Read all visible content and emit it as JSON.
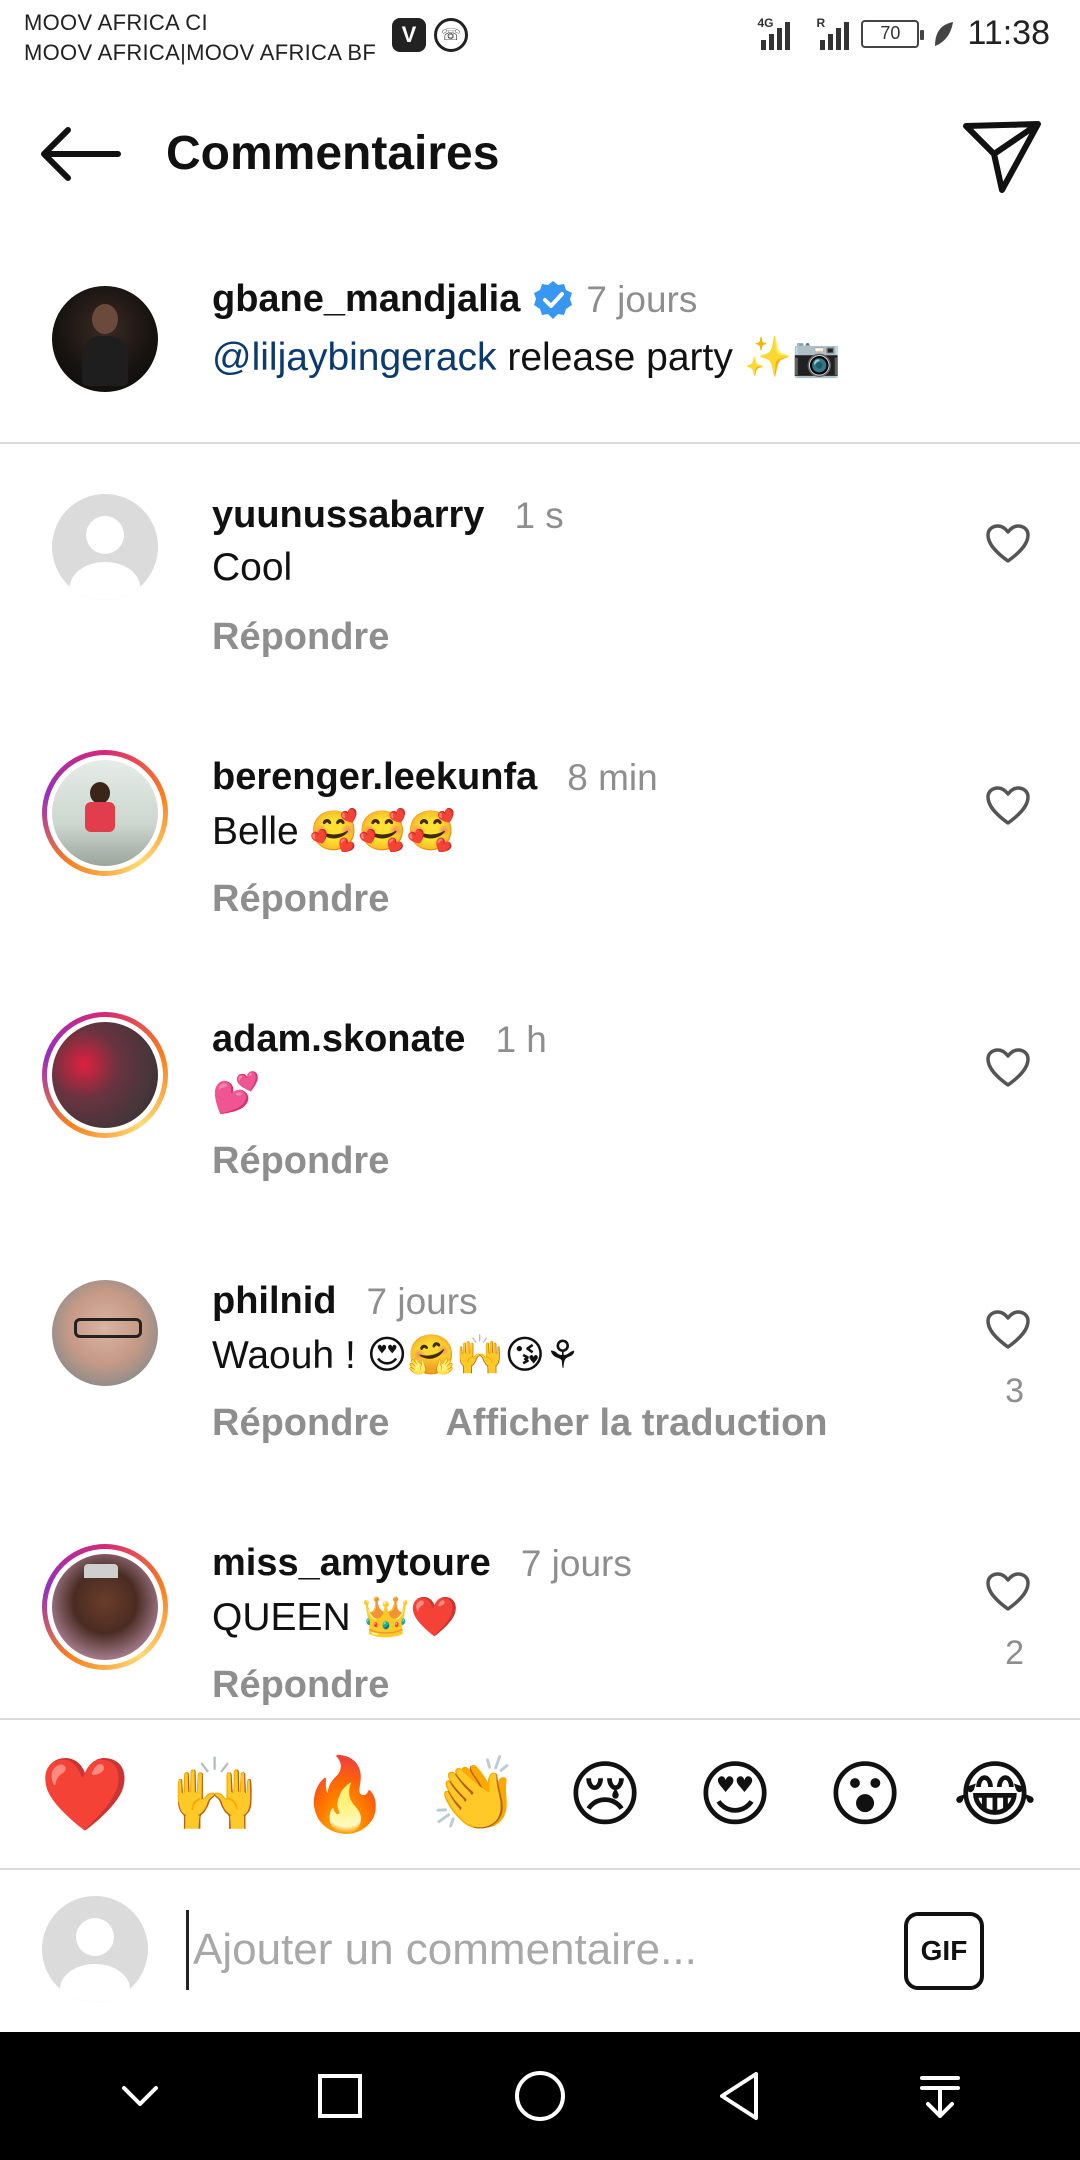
{
  "status_bar": {
    "carrier_line1": "MOOV AFRICA CI",
    "carrier_line2": "MOOV AFRICA|MOOV AFRICA BF",
    "app_icon_v": "V",
    "network_tag_1": "4G",
    "network_tag_2": "R",
    "battery": "70",
    "time": "11:38"
  },
  "header": {
    "title": "Commentaires"
  },
  "caption": {
    "username": "gbane_mandjalia",
    "verified": true,
    "time": "7 jours",
    "mention": "@liljaybingerack",
    "text": " release party ",
    "emojis": "✨📷"
  },
  "comments": [
    {
      "username": "yuunussabarry",
      "time": "1 s",
      "text": "Cool",
      "reply": "Répondre"
    },
    {
      "username": "berenger.leekunfa",
      "time": "8 min",
      "text": "Belle 🥰🥰🥰",
      "reply": "Répondre"
    },
    {
      "username": "adam.skonate",
      "time": "1 h",
      "text": "💕",
      "reply": "Répondre"
    },
    {
      "username": "philnid",
      "time": "7 jours",
      "text": "Waouh ! 😍🤗🙌😘⚘",
      "reply": "Répondre",
      "translate": "Afficher la traduction",
      "likes": "3"
    },
    {
      "username": "miss_amytoure",
      "time": "7 jours",
      "text": "QUEEN 👑❤️",
      "reply": "Répondre",
      "likes": "2"
    }
  ],
  "quick_emojis": [
    "❤️",
    "🙌",
    "🔥",
    "👏",
    "😢",
    "😍",
    "😮",
    "😂"
  ],
  "input": {
    "placeholder": "Ajouter un commentaire...",
    "value": "",
    "gif_label": "GIF"
  },
  "icons": {
    "back": "back-arrow-icon",
    "send": "send-icon",
    "verified": "verified-badge-icon",
    "like": "heart-outline-icon",
    "nav": [
      "chevron-down-icon",
      "square-recents-icon",
      "circle-home-icon",
      "triangle-back-icon",
      "pull-down-icon"
    ]
  },
  "colors": {
    "mention": "#0b3a6f",
    "muted": "#8e8e8e",
    "verified": "#3897f0",
    "navbar": "#000000"
  }
}
